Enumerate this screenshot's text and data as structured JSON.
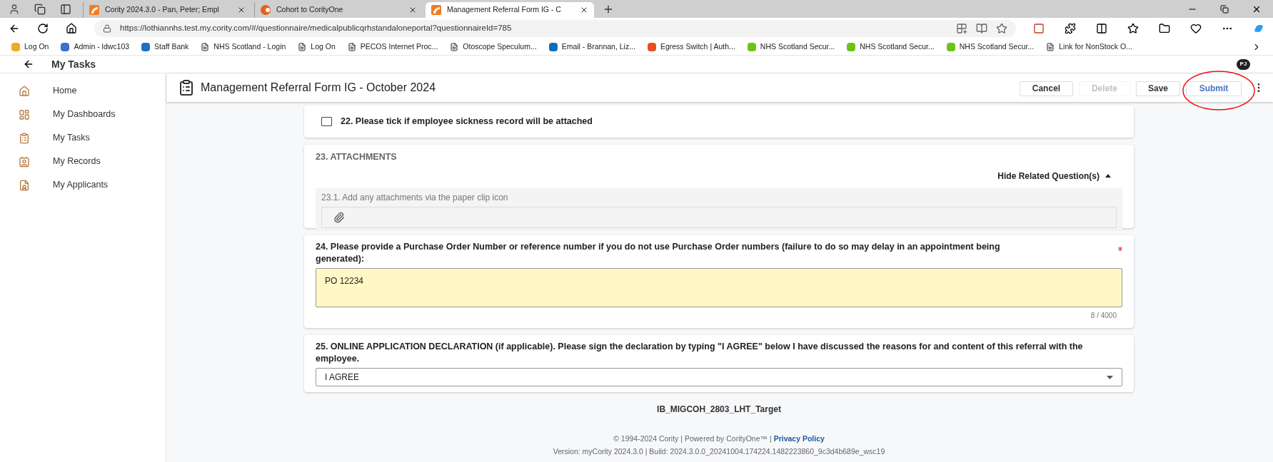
{
  "browser": {
    "tabs": [
      {
        "label": "Cority 2024.3.0 - Pan, Peter; Empl",
        "selected": false,
        "kind": "cority"
      },
      {
        "label": "Cohort to CorityOne",
        "selected": false,
        "kind": "cohort"
      },
      {
        "label": "Management Referral Form IG - C",
        "selected": true,
        "kind": "cority"
      }
    ],
    "url": "https://lothiannhs.test.my.cority.com/#/questionnaire/medicalpublicqrhstandaloneportal?questionnaireId=785",
    "bookmarks": [
      {
        "label": "Log On",
        "kind": "site",
        "color": "#f5a623"
      },
      {
        "label": "Admin - ldwc103",
        "kind": "site",
        "color": "#3b6fd1"
      },
      {
        "label": "Staff Bank",
        "kind": "site",
        "color": "#1f6fc5"
      },
      {
        "label": "NHS Scotland - Login",
        "kind": "page"
      },
      {
        "label": "Log On",
        "kind": "page"
      },
      {
        "label": "PECOS Internet Proc...",
        "kind": "page"
      },
      {
        "label": "Otoscope Speculum...",
        "kind": "page"
      },
      {
        "label": "Email - Brannan, Liz...",
        "kind": "site",
        "color": "#0f6cbd"
      },
      {
        "label": "Egress Switch | Auth...",
        "kind": "site",
        "color": "#e8501f"
      },
      {
        "label": "NHS Scotland Secur...",
        "kind": "site",
        "color": "#6cc417"
      },
      {
        "label": "NHS Scotland Secur...",
        "kind": "site",
        "color": "#6cc417"
      },
      {
        "label": "NHS Scotland Secur...",
        "kind": "site",
        "color": "#6cc417"
      },
      {
        "label": "Link for NonStock O...",
        "kind": "page"
      }
    ]
  },
  "app": {
    "title": "My Tasks",
    "avatar": "PJ"
  },
  "sidebar": {
    "items": [
      {
        "label": "Home",
        "kind": "home"
      },
      {
        "label": "My Dashboards",
        "kind": "dashboards"
      },
      {
        "label": "My Tasks",
        "kind": "tasks"
      },
      {
        "label": "My Records",
        "kind": "records"
      },
      {
        "label": "My Applicants",
        "kind": "applicants"
      }
    ]
  },
  "form": {
    "title": "Management Referral Form IG - October 2024",
    "buttons": [
      {
        "label": "Cancel",
        "disabled": false,
        "primary": false,
        "circled": false
      },
      {
        "label": "Delete",
        "disabled": true,
        "primary": false,
        "circled": false
      },
      {
        "label": "Save",
        "disabled": false,
        "primary": false,
        "circled": false
      },
      {
        "label": "Submit",
        "disabled": false,
        "primary": true,
        "circled": true
      }
    ],
    "questions": [
      {
        "kind": "checkbox",
        "label": "22. Please tick if employee sickness record will be attached",
        "checked": false
      },
      {
        "kind": "attachments",
        "label": "23. ATTACHMENTS",
        "toggle": "Hide Related Question(s)",
        "expanded": true,
        "sub_label": "23.1. Add any attachments via the paper clip icon"
      },
      {
        "kind": "textarea",
        "label": "24. Please provide a Purchase Order Number or reference number if you do not use Purchase Order numbers (failure to do so may delay in an appointment being generated):",
        "required": true,
        "value": "PO 12234",
        "counter": "8 / 4000"
      },
      {
        "kind": "select",
        "label": "25. ONLINE APPLICATION DECLARATION (if applicable). Please sign the declaration by typing \"I AGREE\" below I have discussed the reasons for and content of this referral with the employee.",
        "value": "I AGREE"
      }
    ]
  },
  "footer": {
    "target": "IB_MIGCOH_2803_LHT_Target",
    "copyright": "© 1994-2024 Cority | Powered by CorityOne™ |",
    "privacy": "Privacy Policy",
    "version": "Version: myCority 2024.3.0 | Build: 2024.3.0.0_20241004.174224.1482223860_9c3d4b689e_wsc19"
  }
}
